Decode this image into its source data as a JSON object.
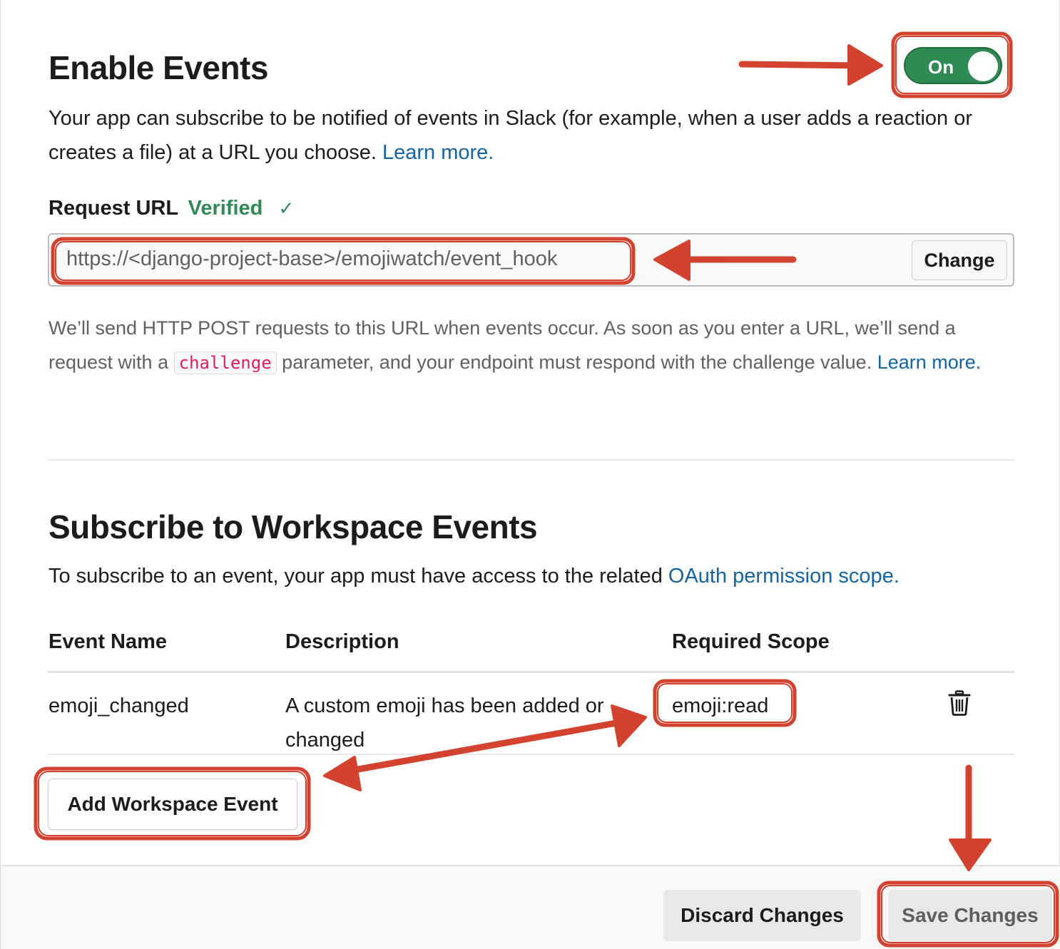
{
  "enable_events": {
    "title": "Enable Events",
    "toggle_label": "On",
    "description": "Your app can subscribe to be notified of events in Slack (for example, when a user adds a reaction or creates a file) at a URL you choose.",
    "learn_more": "Learn more."
  },
  "request_url": {
    "label": "Request URL",
    "status": "Verified",
    "check": "✓",
    "value": "https://<django-project-base>/emojiwatch/event_hook",
    "change_label": "Change",
    "help_before": "We’ll send HTTP POST requests to this URL when events occur. As soon as you enter a URL, we’ll send a request with a",
    "help_code": "challenge",
    "help_after": "parameter, and your endpoint must respond with the challenge value.",
    "help_link": "Learn more."
  },
  "workspace_events": {
    "title": "Subscribe to Workspace Events",
    "description": "To subscribe to an event, your app must have access to the related",
    "scope_link": "OAuth permission scope.",
    "columns": [
      "Event Name",
      "Description",
      "Required Scope"
    ],
    "rows": [
      {
        "event_name": "emoji_changed",
        "description_line1": "A custom emoji has been added or",
        "description_line2": "changed",
        "scope": "emoji:read",
        "delete_icon": "trash-icon"
      }
    ],
    "add_label": "Add Workspace Event"
  },
  "footer": {
    "discard_label": "Discard Changes",
    "save_label": "Save Changes"
  },
  "colors": {
    "toggle_on": "#2f8a54",
    "link": "#1264a3",
    "code": "#e01e5a",
    "annotation": "#d0321e"
  }
}
